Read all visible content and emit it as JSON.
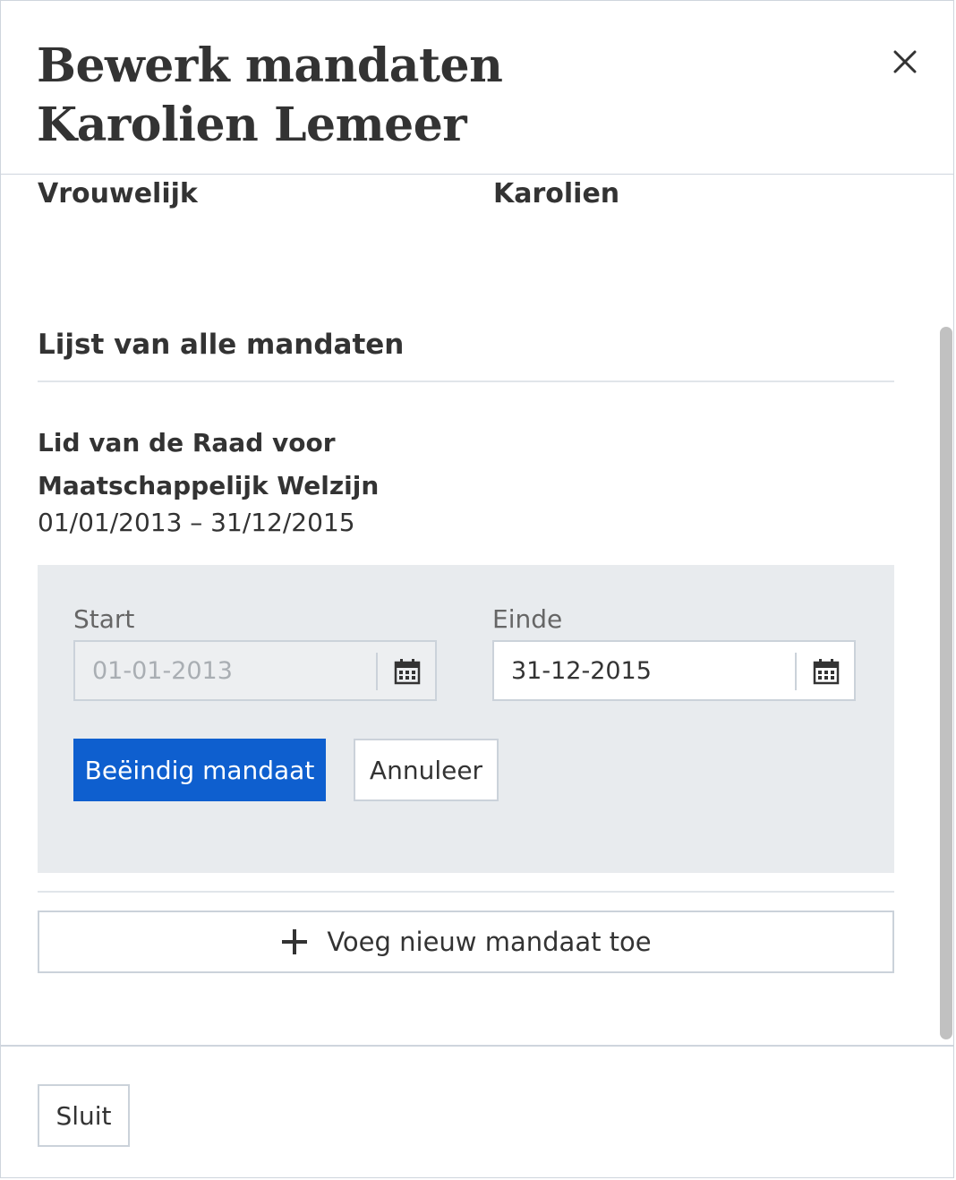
{
  "modal": {
    "title_line1": "Bewerk mandaten",
    "title_line2": "Karolien Lemeer",
    "close_icon": "close-icon"
  },
  "person": {
    "gender": "Vrouwelijk",
    "first_name": "Karolien"
  },
  "mandates_section": {
    "heading": "Lijst van alle mandaten"
  },
  "mandate": {
    "title": "Lid van de Raad voor Maatschappelijk Welzijn",
    "dates": "01/01/2013 – 31/12/2015",
    "edit": {
      "start_label": "Start",
      "start_value": "01-01-2013",
      "end_label": "Einde",
      "end_value": "31-12-2015",
      "calendar_icon": "calendar-icon",
      "confirm_label": "Beëindig mandaat",
      "cancel_label": "Annuleer"
    }
  },
  "add_mandate": {
    "label": "Voeg nieuw mandaat toe",
    "icon": "plus-icon"
  },
  "footer": {
    "close_label": "Sluit"
  },
  "colors": {
    "primary": "#0e5fcf",
    "panel_bg": "#e8ebee",
    "border": "#cbd2da"
  }
}
